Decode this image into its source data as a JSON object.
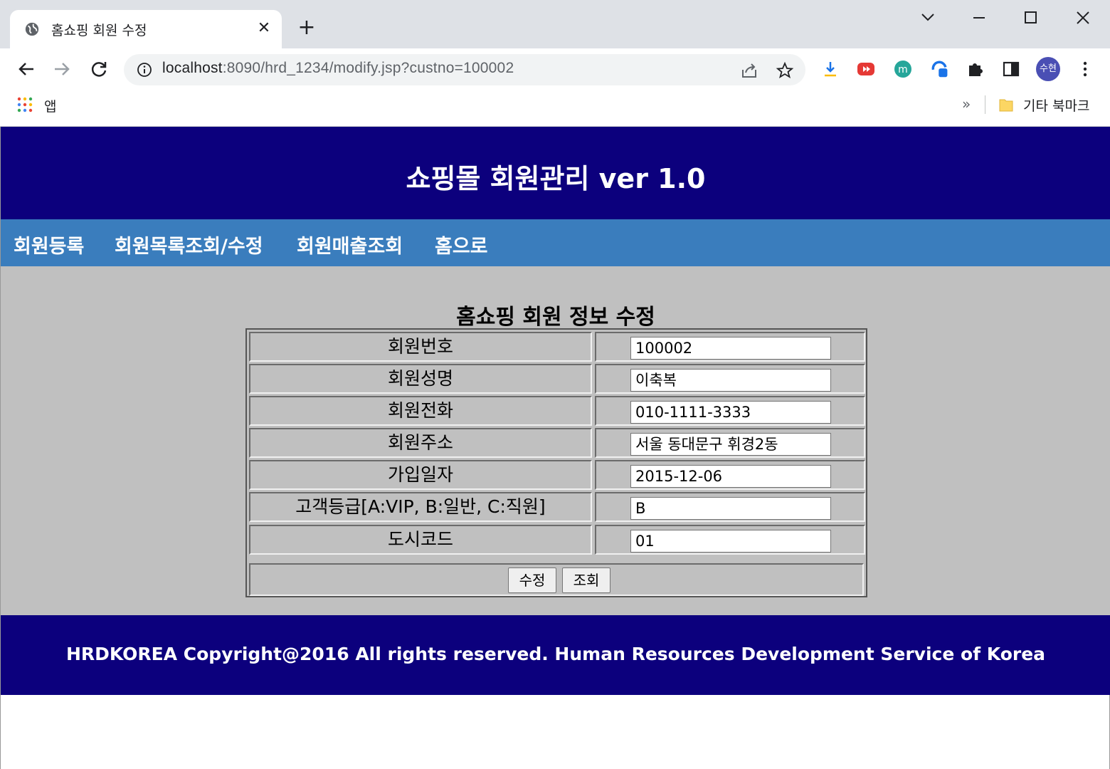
{
  "browser": {
    "tab_title": "홈쇼핑 회원 수정",
    "url_host": "localhost",
    "url_path": ":8090/hrd_1234/modify.jsp?custno=100002",
    "profile_initials": "수현",
    "bookmarks": {
      "apps_label": "앱",
      "more": "»",
      "other_bookmarks_label": "기타 북마크"
    }
  },
  "site": {
    "title": "쇼핑몰 회원관리 ver 1.0",
    "nav": [
      {
        "label": "회원등록"
      },
      {
        "label": "회원목록조회/수정"
      },
      {
        "label": "회원매출조회"
      },
      {
        "label": "홈으로"
      }
    ],
    "form": {
      "title": "홈쇼핑 회원 정보 수정",
      "fields": [
        {
          "label": "회원번호",
          "value": "100002"
        },
        {
          "label": "회원성명",
          "value": "이축복"
        },
        {
          "label": "회원전화",
          "value": "010-1111-3333"
        },
        {
          "label": "회원주소",
          "value": "서울 동대문구 휘경2동"
        },
        {
          "label": "가입일자",
          "value": "2015-12-06"
        },
        {
          "label": "고객등급[A:VIP, B:일반, C:직원]",
          "value": "B"
        },
        {
          "label": "도시코드",
          "value": "01"
        }
      ],
      "buttons": {
        "modify": "수정",
        "lookup": "조회"
      }
    },
    "footer": "HRDKOREA Copyright@2016 All rights reserved. Human Resources Development Service of Korea"
  },
  "colors": {
    "header_bg": "#0c007d",
    "nav_bg": "#3a7dbd",
    "main_bg": "#c0c0c0",
    "footer_bg": "#0c007d"
  },
  "icons": [
    "globe-icon",
    "close-icon",
    "plus-icon",
    "chevron-down-icon",
    "minimize-icon",
    "maximize-icon",
    "back-icon",
    "forward-icon",
    "reload-icon",
    "info-icon",
    "share-icon",
    "star-icon",
    "extension-icon",
    "puzzle-icon",
    "sidepanel-icon",
    "menu-icon",
    "apps-icon",
    "folder-icon"
  ]
}
